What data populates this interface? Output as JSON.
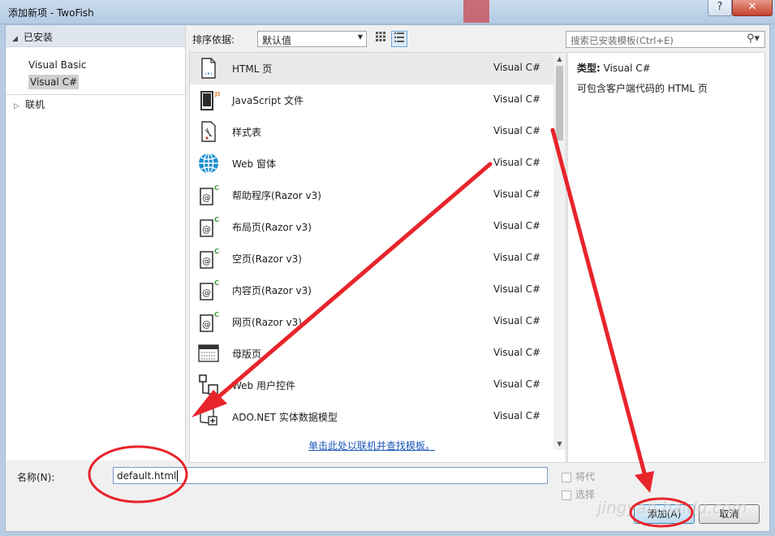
{
  "window": {
    "title": "添加新项 - TwoFish",
    "help_label": "?",
    "close_label": "✕"
  },
  "tree": {
    "installed_label": "已安装",
    "children": [
      "Visual Basic",
      "Visual C#"
    ],
    "online_label": "联机"
  },
  "toolbar": {
    "sort_label": "排序依据:",
    "sort_value": "默认值",
    "search_placeholder": "搜索已安装模板(Ctrl+E)"
  },
  "templates": [
    {
      "name": "HTML 页",
      "type": "Visual C#",
      "icon": "html-page-icon",
      "selected": true
    },
    {
      "name": "JavaScript 文件",
      "type": "Visual C#",
      "icon": "javascript-file-icon"
    },
    {
      "name": "样式表",
      "type": "Visual C#",
      "icon": "stylesheet-icon"
    },
    {
      "name": "Web 窗体",
      "type": "Visual C#",
      "icon": "web-form-icon"
    },
    {
      "name": "帮助程序(Razor v3)",
      "type": "Visual C#",
      "icon": "razor-page-icon"
    },
    {
      "name": "布局页(Razor v3)",
      "type": "Visual C#",
      "icon": "razor-page-icon"
    },
    {
      "name": "空页(Razor v3)",
      "type": "Visual C#",
      "icon": "razor-page-icon"
    },
    {
      "name": "内容页(Razor v3)",
      "type": "Visual C#",
      "icon": "razor-page-icon"
    },
    {
      "name": "网页(Razor v3)",
      "type": "Visual C#",
      "icon": "razor-page-icon"
    },
    {
      "name": "母版页",
      "type": "Visual C#",
      "icon": "master-page-icon"
    },
    {
      "name": "Web 用户控件",
      "type": "Visual C#",
      "icon": "user-control-icon"
    },
    {
      "name": "ADO.NET 实体数据模型",
      "type": "Visual C#",
      "icon": "entity-model-icon"
    }
  ],
  "online_link": "单击此处以联机并查找模板。",
  "details": {
    "type_label": "类型:",
    "type_value": "Visual C#",
    "description": "可包含客户端代码的 HTML 页"
  },
  "bottom": {
    "name_label": "名称(N):",
    "name_value": "default.html",
    "checkbox1_label": "将代",
    "checkbox2_label": "选择",
    "add_label": "添加(A)",
    "cancel_label": "取消"
  },
  "watermark": "jingyan.baidu.com",
  "colors": {
    "annotation_red": "#e8242b",
    "link_blue": "#1a56b8",
    "selected_row": "#eae8ea"
  }
}
